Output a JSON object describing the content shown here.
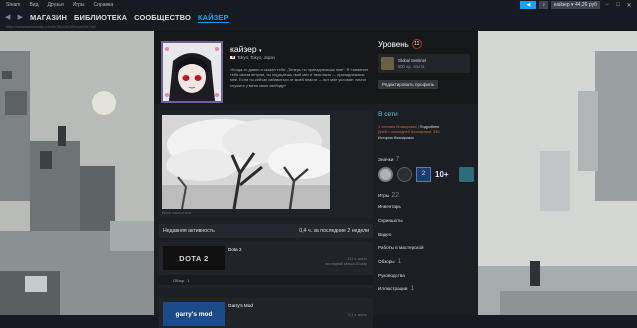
{
  "menubar": {
    "items": [
      "Steam",
      "Вид",
      "Друзья",
      "Игры",
      "Справка"
    ]
  },
  "window": {
    "username": "кайзер",
    "balance": "44,26 руб"
  },
  "nav": {
    "back": "◀",
    "forward": "▶",
    "items": [
      "МАГАЗИН",
      "БИБЛИОТЕКА",
      "СООБЩЕСТВО",
      "КАЙЗЕР"
    ]
  },
  "url": "https://steamcommunity.com/id/78hJ2f4189/nice2017/pt/",
  "profile": {
    "name": "кайзер",
    "location": "Tokyo, Tokyo, Japan",
    "quote": "«Когда-то давно я сказал тебе: „Теперь ты принадлежишь мне“. Я «заменил тебя своим ветром, ты ощущаешь твой мех и твои выть — принадлежишь мне. Если ты сейчас избавиться от моей власти — вот мое условие: начни служить у меня свою свободу»",
    "level_label": "Уровень",
    "level": "11",
    "badge_name": "Global Sentinel",
    "badge_xp": "500 ед. опыта",
    "edit_button": "Редактировать профиль"
  },
  "showcase": {
    "caption": "Black sakura tree"
  },
  "activity": {
    "title": "Недавняя активность",
    "hours": "0,4 ч. за последние 2 недели",
    "games": [
      {
        "name": "Dota 2",
        "capsule": "DOTA 2",
        "stats1": "333 ч. всего",
        "stats2": "последний запуск 20 мар",
        "footer_label": "Обзор",
        "footer_count": "1"
      },
      {
        "name": "Garry's Mod",
        "capsule": "garry's mod",
        "stats1": "2,3 ч. всего",
        "stats2": "",
        "footer_label": "",
        "footer_count": ""
      }
    ]
  },
  "sidebar": {
    "status": "В сети",
    "friends_line1_pre": "1 человек блокировка",
    "friends_line1_post": "Подробнее",
    "friends_line2": "Дней с последней блокировки: 330",
    "friends_line3": "История блокировок",
    "badges_label": "Значки",
    "badges_count": "7",
    "badge_years": "10+",
    "badge_mid": "2",
    "games_label": "Игры",
    "games_count": "22",
    "links": [
      {
        "label": "Инвентарь",
        "count": ""
      },
      {
        "label": "Скриншоты",
        "count": ""
      },
      {
        "label": "Видео",
        "count": ""
      },
      {
        "label": "Работы в мастерской",
        "count": ""
      },
      {
        "label": "Обзоры",
        "count": "1"
      },
      {
        "label": "Руководства",
        "count": ""
      },
      {
        "label": "Иллюстрации",
        "count": "1"
      }
    ]
  }
}
